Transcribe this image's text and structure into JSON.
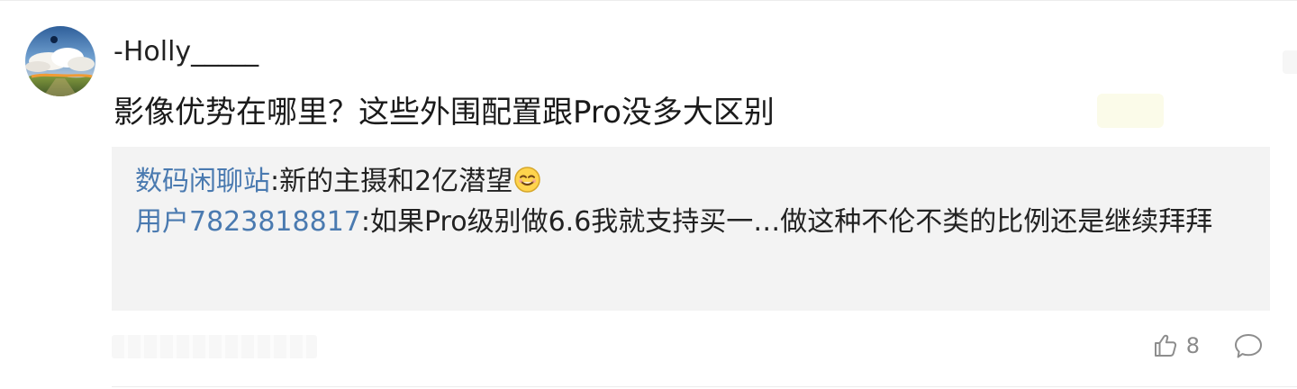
{
  "comment": {
    "username": "-Holly_____",
    "text": "影像优势在哪里？这些外围配置跟Pro没多大区别",
    "avatar_icon": "landscape-avatar",
    "timestamp": "",
    "like_count": "8"
  },
  "replies": [
    {
      "author": "数码闲聊站",
      "separator": ":",
      "text": "新的主摄和2亿潜望",
      "emoji": "smile-emoji"
    },
    {
      "author": "用户7823818817",
      "separator": ":",
      "text": "如果Pro级别做6.6我就支持买一…做这种不伦不类的比例还是继续拜拜"
    }
  ],
  "actions": {
    "like_icon": "thumbs-up-icon",
    "reply_icon": "comment-bubble-icon"
  },
  "colors": {
    "author_link": "#4a7ab0",
    "reply_background": "#f3f3f3",
    "muted_text": "#8a8a8a"
  }
}
